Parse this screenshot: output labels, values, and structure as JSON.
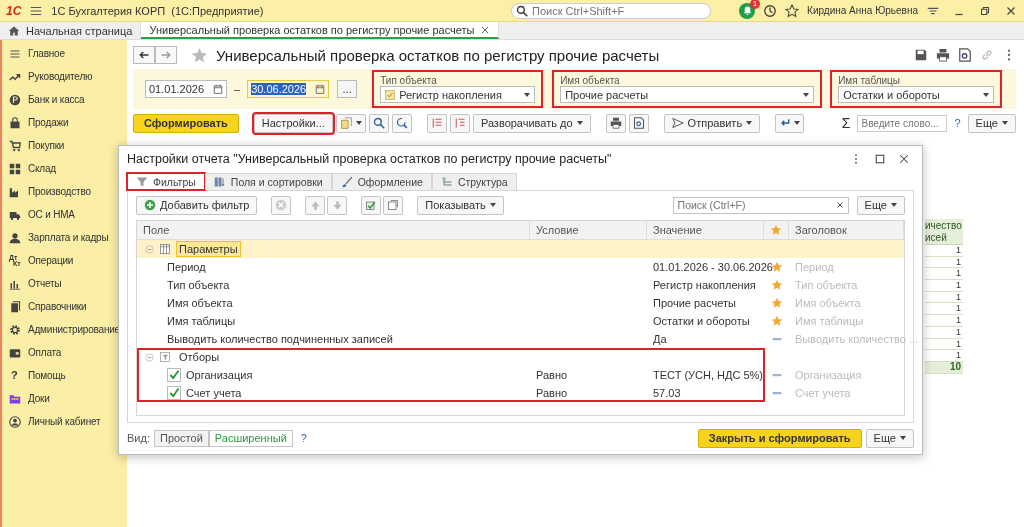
{
  "app": {
    "logo": "1С",
    "title": "1С Бухгалтерия КОРП  (1С:Предприятие)",
    "search_placeholder": "Поиск Ctrl+Shift+F",
    "notification_count": "1",
    "user": "Кирдина Анна Юрьевна"
  },
  "tabs": [
    {
      "label": "Начальная страница",
      "selected": false
    },
    {
      "label": "Универсальный проверка остатков по регистру прочие расчеты",
      "selected": true
    }
  ],
  "sidebar": {
    "items": [
      {
        "label": "Главное"
      },
      {
        "label": "Руководителю"
      },
      {
        "label": "Банк и касса"
      },
      {
        "label": "Продажи"
      },
      {
        "label": "Покупки"
      },
      {
        "label": "Склад"
      },
      {
        "label": "Производство"
      },
      {
        "label": "ОС и НМА"
      },
      {
        "label": "Зарплата и кадры"
      },
      {
        "label": "Операции",
        "icon_text": [
          "Дт",
          "Кт"
        ]
      },
      {
        "label": "Отчеты"
      },
      {
        "label": "Справочники"
      },
      {
        "label": "Администрирование"
      },
      {
        "label": "Оплата"
      },
      {
        "label": "Помощь",
        "icon_text": [
          "?"
        ]
      },
      {
        "label": "Доки"
      },
      {
        "label": "Личный кабинет"
      }
    ]
  },
  "report": {
    "title": "Универсальный проверка остатков по регистру прочие расчеты",
    "dates": [
      {
        "value": "01.01.2026",
        "focused": false
      },
      {
        "value": "30.06.2026",
        "focused": true
      }
    ],
    "date_separator": "–",
    "more_button": "...",
    "fields": [
      {
        "label": "Тип объекта",
        "value": "Регистр накопления",
        "highlighted": true
      },
      {
        "label": "Имя объекта",
        "value": "Прочие расчеты",
        "highlighted": true
      },
      {
        "label": "Имя таблицы",
        "value": "Остатки и обороты",
        "highlighted": true
      }
    ],
    "toolbar": {
      "generate": "Сформировать",
      "settings": {
        "label": "Настройки...",
        "highlighted": true
      },
      "expand": "Разворачивать до",
      "send": "Отправить",
      "sum_sign": "Σ",
      "search_placeholder": "Введите слово...",
      "help": "?",
      "more": "Еще"
    },
    "table": {
      "header": [
        "ичество",
        "исей"
      ],
      "rows": [
        "1",
        "1",
        "1",
        "1",
        "1",
        "1",
        "1",
        "1",
        "1",
        "1"
      ],
      "total": "10"
    }
  },
  "dialog": {
    "title": "Настройки отчета \"Универсальный проверка остатков по регистру прочие расчеты\"",
    "tabs": [
      {
        "label": "Фильтры",
        "selected": true,
        "highlighted": true
      },
      {
        "label": "Поля и сортировки",
        "selected": false
      },
      {
        "label": "Оформление",
        "selected": false
      },
      {
        "label": "Структура",
        "selected": false
      }
    ],
    "toolbar": {
      "add_filter": "Добавить фильтр",
      "show": "Показывать",
      "search_placeholder": "Поиск (Ctrl+F)",
      "more": "Еще"
    },
    "columns": [
      {
        "kind": "text",
        "label": "Поле"
      },
      {
        "kind": "text",
        "label": "Условие"
      },
      {
        "kind": "text",
        "label": "Значение"
      },
      {
        "kind": "star"
      },
      {
        "kind": "text",
        "label": "Заголовок"
      }
    ],
    "groups": [
      {
        "label": "Параметры",
        "expanded": true,
        "selected": true,
        "children": [
          {
            "kind": "parameter",
            "field": "Период",
            "value": "01.01.2026 - 30.06.2026",
            "favorite": true,
            "caption": "Период"
          },
          {
            "kind": "parameter",
            "field": "Тип объекта",
            "value": "Регистр накопления",
            "favorite": true,
            "caption": "Тип объекта"
          },
          {
            "kind": "parameter",
            "field": "Имя объекта",
            "value": "Прочие расчеты",
            "favorite": true,
            "caption": "Имя объекта"
          },
          {
            "kind": "parameter",
            "field": "Имя таблицы",
            "value": "Остатки и обороты",
            "favorite": true,
            "caption": "Имя таблицы"
          },
          {
            "kind": "parameter",
            "field": "Выводить количество подчиненных записей",
            "value": "Да",
            "favorite": false,
            "caption": "Выводить количество ..."
          }
        ]
      },
      {
        "label": "Отборы",
        "expanded": true,
        "selected": false,
        "highlighted": true,
        "children": [
          {
            "kind": "filter",
            "checked": true,
            "field": "Организация",
            "condition": "Равно",
            "value": "ТЕСТ (УСН, НДС 5%)",
            "favorite": false,
            "caption": "Организация"
          },
          {
            "kind": "filter",
            "checked": true,
            "field": "Счет учета",
            "condition": "Равно",
            "value": "57.03",
            "favorite": false,
            "caption": "Счет учета"
          }
        ]
      }
    ],
    "footer": {
      "view_label": "Вид:",
      "views": [
        {
          "label": "Простой",
          "selected": false
        },
        {
          "label": "Расширенный",
          "selected": true
        }
      ],
      "help": "?",
      "close_generate": "Закрыть и сформировать",
      "more": "Еще"
    }
  }
}
